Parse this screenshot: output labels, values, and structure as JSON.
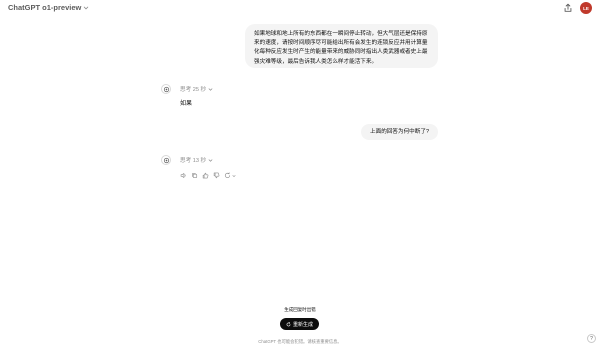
{
  "header": {
    "model_name": "ChatGPT o1-preview",
    "model_chevron_icon": "chevron-down-icon",
    "share_icon": "share-icon",
    "avatar_initials": "LE",
    "avatar_color": "#c0392b"
  },
  "conversation": {
    "messages": [
      {
        "role": "user",
        "text": "如果地球和地上所有的东西都在一瞬间停止转动，但大气层还是保持原来的速度，请按时间顺序尽可能给出所有会发生的连锁反应并用计算量化每种反应发生时产生的能量带来的威胁同时指出人类武器或者史上最强灾难等级，最后告诉我人类怎么样才能活下来。"
      },
      {
        "role": "assistant",
        "thinking": "思考 25 秒",
        "text": "如果"
      },
      {
        "role": "user",
        "text": "上面的回答为何中断了?"
      },
      {
        "role": "assistant",
        "thinking": "思考 13 秒",
        "text": ""
      }
    ]
  },
  "action_icons": [
    "speaker-icon",
    "copy-icon",
    "thumbs-up-icon",
    "thumbs-down-icon",
    "regenerate-icon"
  ],
  "bottom": {
    "stop_note": "生成回复时出错",
    "regenerate_label": "重新生成",
    "footer_text": "ChatGPT 也可能会犯错。请核查重要信息。",
    "help_label": "?"
  },
  "colors": {
    "bubble_bg": "#f4f4f4",
    "button_bg": "#0d0d0d",
    "muted_text": "#8f8f8f"
  }
}
